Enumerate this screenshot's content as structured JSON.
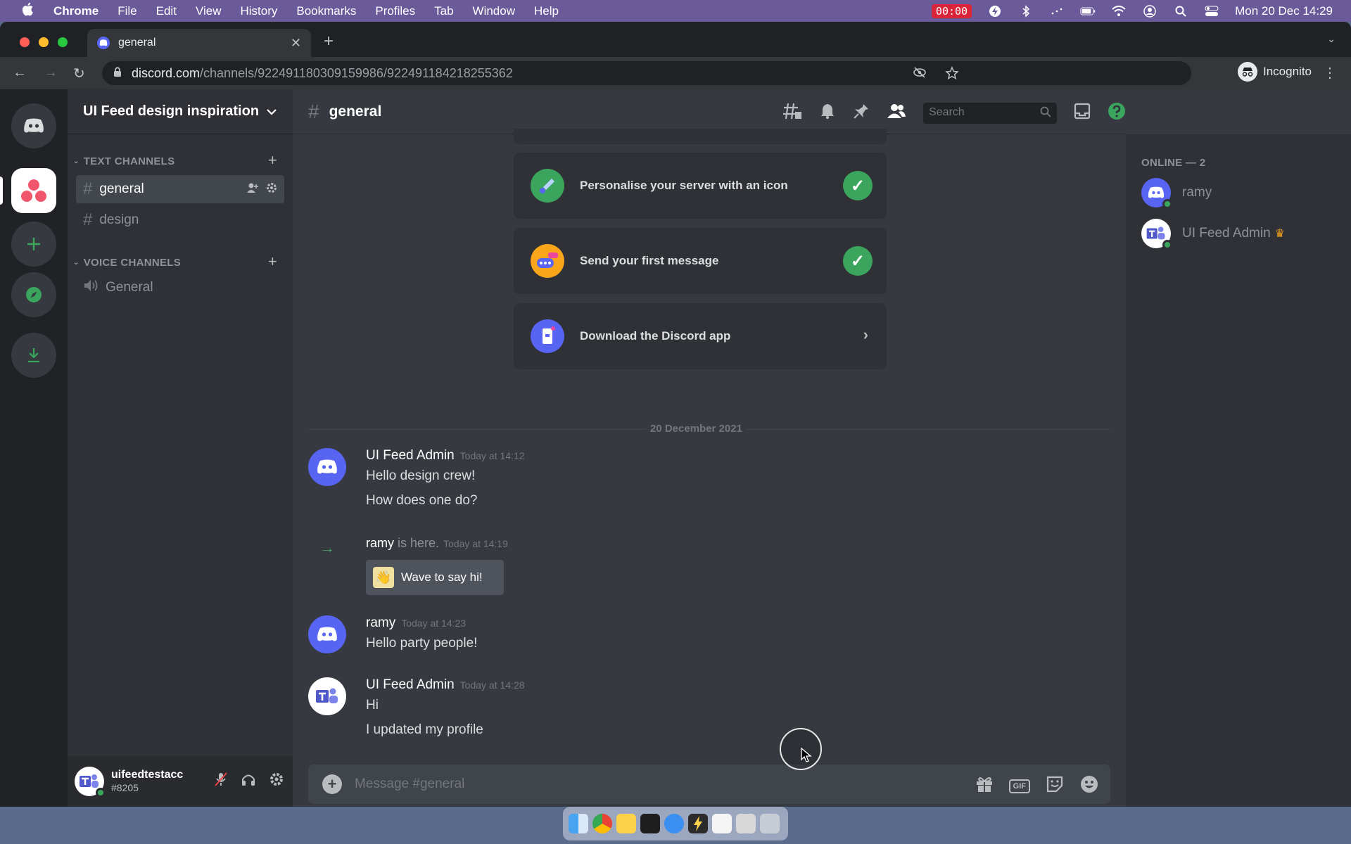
{
  "menubar": {
    "apple": "",
    "app_name": "Chrome",
    "menus": [
      "File",
      "Edit",
      "View",
      "History",
      "Bookmarks",
      "Profiles",
      "Tab",
      "Window",
      "Help"
    ],
    "record_time": "00:00",
    "datetime": "Mon 20 Dec  14:29"
  },
  "browser": {
    "tab_title": "general",
    "url_host": "discord.com",
    "url_path": "/channels/922491180309159986/922491184218255362",
    "incognito_label": "Incognito"
  },
  "server": {
    "name": "UI Feed design inspiration",
    "text_category": "TEXT CHANNELS",
    "voice_category": "VOICE CHANNELS",
    "text_channels": [
      "general",
      "design"
    ],
    "voice_channels": [
      "General"
    ]
  },
  "user": {
    "name": "uifeedtestacc",
    "tag": "#8205"
  },
  "channel": {
    "name": "general",
    "search_placeholder": "Search"
  },
  "onboarding": {
    "personalise": "Personalise your server with an icon",
    "first_message": "Send your first message",
    "download": "Download the Discord app"
  },
  "date_divider": "20 December 2021",
  "messages": [
    {
      "author": "UI Feed Admin",
      "time": "Today at 14:12",
      "lines": [
        "Hello design crew!",
        "How does one do?"
      ]
    },
    {
      "author": "ramy",
      "joined_text": " is here.",
      "time": "Today at 14:19",
      "wave": "Wave to say hi!"
    },
    {
      "author": "ramy",
      "time": "Today at 14:23",
      "lines": [
        "Hello party people!"
      ]
    },
    {
      "author": "UI Feed Admin",
      "time": "Today at 14:28",
      "lines": [
        "Hi",
        "I updated my profile"
      ]
    }
  ],
  "composer": {
    "placeholder": "Message #general",
    "gif": "GIF"
  },
  "members": {
    "header": "ONLINE — 2",
    "list": [
      {
        "name": "ramy"
      },
      {
        "name": "UI Feed Admin"
      }
    ]
  },
  "colors": {
    "blurple": "#5865f2",
    "green": "#3ba55d",
    "bg": "#36393f"
  }
}
